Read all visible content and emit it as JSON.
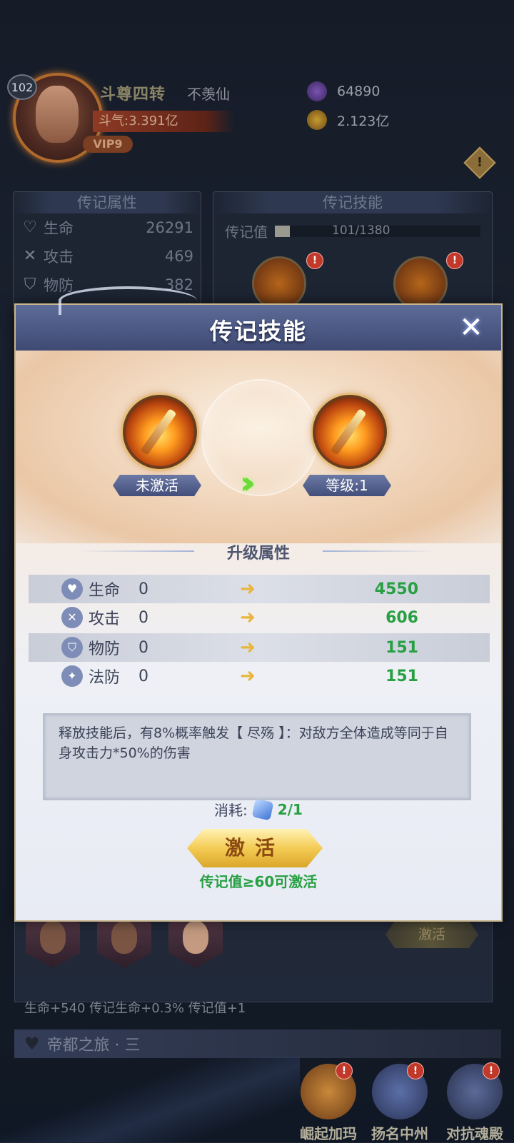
{
  "player": {
    "level": "102",
    "rank_title": "斗尊四转",
    "name": "不羡仙",
    "power": "斗气:3.391亿",
    "vip": "VIP9"
  },
  "currency": {
    "gems": "64890",
    "gold": "2.123亿"
  },
  "biography_attrs": {
    "title": "传记属性",
    "rows": [
      {
        "label": "生命",
        "value": "26291"
      },
      {
        "label": "攻击",
        "value": "469"
      },
      {
        "label": "物防",
        "value": "382"
      }
    ]
  },
  "biography_skills_bg": {
    "title": "传记技能",
    "progress_label": "传记值",
    "progress_text": "101/1380",
    "progress": 0.073,
    "badge": "!"
  },
  "modal": {
    "title": "传记技能",
    "close": "✕",
    "left_skill_label": "未激活",
    "right_skill_label": "等级:1",
    "section_title": "升级属性",
    "stats": [
      {
        "icon": "heart-icon",
        "name": "生命",
        "old": "0",
        "new": "4550"
      },
      {
        "icon": "swords-icon",
        "name": "攻击",
        "old": "0",
        "new": "606"
      },
      {
        "icon": "shield-icon",
        "name": "物防",
        "old": "0",
        "new": "151"
      },
      {
        "icon": "magic-shield-icon",
        "name": "法防",
        "old": "0",
        "new": "151"
      }
    ],
    "description": "释放技能后，有8%概率触发【 尽殇 】：对敌方全体造成等同于自身攻击力*50%的伤害",
    "cost_label": "消耗:",
    "cost_value": "2/1",
    "activate_label": "激活",
    "hint": "传记值≥60可激活"
  },
  "lower": {
    "activate_label": "激活",
    "bonus_text": "生命+540 传记生命+0.3% 传记值+1",
    "journey_title": "帝都之旅 · 三"
  },
  "nav": [
    {
      "label": "崛起加玛"
    },
    {
      "label": "扬名中州"
    },
    {
      "label": "对抗魂殿"
    }
  ],
  "colors": {
    "accent_green": "#27a043",
    "modal_header": "#4a5680",
    "gold_button": "#f4cc55"
  }
}
